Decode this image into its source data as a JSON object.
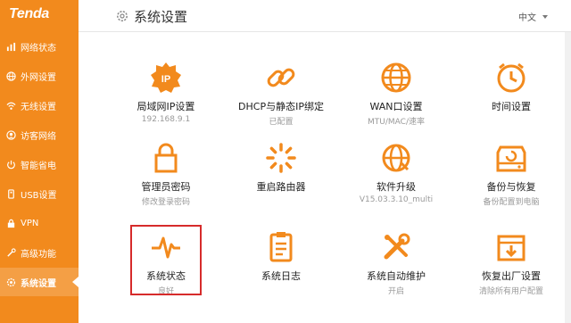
{
  "brand": {
    "logo_text": "Tenda",
    "accent_color": "#f28a1d"
  },
  "sidebar": {
    "items": [
      {
        "label": "网络状态",
        "icon": "network-status-icon"
      },
      {
        "label": "外网设置",
        "icon": "globe-icon"
      },
      {
        "label": "无线设置",
        "icon": "wifi-icon"
      },
      {
        "label": "访客网络",
        "icon": "guest-icon"
      },
      {
        "label": "智能省电",
        "icon": "power-save-icon"
      },
      {
        "label": "USB设置",
        "icon": "usb-icon"
      },
      {
        "label": "VPN",
        "icon": "vpn-icon"
      },
      {
        "label": "高级功能",
        "icon": "tools-icon"
      },
      {
        "label": "系统设置",
        "icon": "settings-icon",
        "active": true
      }
    ]
  },
  "header": {
    "title": "系统设置",
    "language": "中文"
  },
  "tiles": [
    {
      "label": "局域网IP设置",
      "sub": "192.168.9.1",
      "icon": "lan-ip-icon"
    },
    {
      "label": "DHCP与静态IP绑定",
      "sub": "已配置",
      "icon": "link-icon"
    },
    {
      "label": "WAN口设置",
      "sub": "MTU/MAC/速率",
      "icon": "globe-icon"
    },
    {
      "label": "时间设置",
      "sub": "",
      "icon": "clock-icon"
    },
    {
      "label": "管理员密码",
      "sub": "修改登录密码",
      "icon": "lock-icon"
    },
    {
      "label": "重启路由器",
      "sub": "",
      "icon": "restart-icon"
    },
    {
      "label": "软件升级",
      "sub": "V15.03.3.10_multi",
      "icon": "upgrade-icon"
    },
    {
      "label": "备份与恢复",
      "sub": "备份配置到电脑",
      "icon": "backup-icon"
    },
    {
      "label": "系统状态",
      "sub": "良好",
      "icon": "pulse-icon"
    },
    {
      "label": "系统日志",
      "sub": "",
      "icon": "log-icon"
    },
    {
      "label": "系统自动维护",
      "sub": "开启",
      "icon": "maintenance-icon"
    },
    {
      "label": "恢复出厂设置",
      "sub": "清除所有用户配置",
      "icon": "factory-reset-icon"
    }
  ]
}
